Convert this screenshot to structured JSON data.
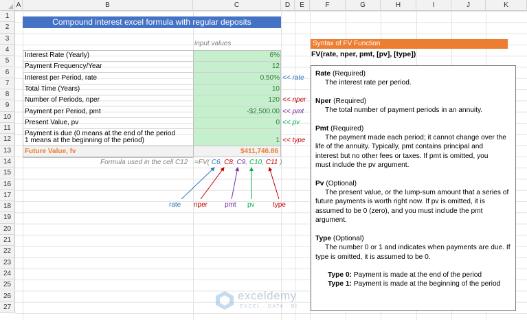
{
  "columns": [
    "A",
    "B",
    "C",
    "D",
    "E",
    "F",
    "G",
    "H",
    "I",
    "J",
    "K"
  ],
  "rows": [
    "1",
    "2",
    "3",
    "4",
    "5",
    "6",
    "7",
    "8",
    "9",
    "10",
    "11",
    "12",
    "13",
    "14",
    "15",
    "16",
    "17",
    "18",
    "19",
    "20",
    "21",
    "22",
    "23",
    "24",
    "25",
    "26",
    "27"
  ],
  "title": "Compound interest excel formula with regular deposits",
  "input_values_caption": "input values",
  "table": [
    {
      "label": "Interest Rate (Yearly)",
      "value": "6%",
      "note": ""
    },
    {
      "label": "Payment Frequency/Year",
      "value": "12",
      "note": ""
    },
    {
      "label": "Interest per Period, rate",
      "value": "0.50%",
      "note": "<< rate"
    },
    {
      "label": "Total Time (Years)",
      "value": "10",
      "note": ""
    },
    {
      "label": "Number of Periods, nper",
      "value": "120",
      "note": "<< nper"
    },
    {
      "label": "Payment per Period, pmt",
      "value": "-$2,500.00",
      "note": "<< pmt"
    },
    {
      "label": "Present Value, pv",
      "value": "0",
      "note": "<< pv"
    },
    {
      "label": "Payment is due (0 means at the end of the period",
      "value": "",
      "note": ""
    },
    {
      "label": "1 means at the beginning of the period)",
      "value": "1",
      "note": "<< type"
    }
  ],
  "future_value": {
    "label": "Future Value, fv",
    "value": "$411,746.86"
  },
  "formula": {
    "caption": "Formula used in the cell C12",
    "prefix": "=FV(",
    "c6": "C6",
    "c8": "C8",
    "c9": "C9",
    "c10": "C10",
    "c11": "C11",
    "sep": ",",
    "suffix": ")"
  },
  "arrow_labels": {
    "rate": "rate",
    "nper": "nper",
    "pmt": "pmt",
    "pv": "pv",
    "type": "type"
  },
  "syntax": {
    "heading": "Syntax of FV Function",
    "signature": "FV(rate, nper, pmt, [pv], [type])"
  },
  "help": {
    "rate_title": "Rate",
    "rate_tag": "(Required)",
    "rate_desc": "The interest rate per period.",
    "nper_title": "Nper",
    "nper_tag": "(Required)",
    "nper_desc": "The total number of payment periods in an annuity.",
    "pmt_title": "Pmt",
    "pmt_tag": "(Required)",
    "pmt_desc1": "The payment made each period; it cannot change over the",
    "pmt_desc2": "life of the annuity. Typically, pmt contains principal and",
    "pmt_desc3": "interest but no other fees or taxes. If pmt is omitted, you",
    "pmt_desc4": "must include the pv argument.",
    "pv_title": "Pv",
    "pv_tag": "(Optional)",
    "pv_desc1": "The present value, or the lump-sum amount that a series of",
    "pv_desc2": "future payments is worth right now. If pv is omitted, it is",
    "pv_desc3": "assumed to be 0 (zero), and you must include the pmt",
    "pv_desc4": "argument.",
    "type_title": "Type",
    "type_tag": "(Optional)",
    "type_desc1": "The number 0 or 1 and indicates when payments are due. If",
    "type_desc2": "type is omitted, it is assumed to be 0.",
    "type0_bold": "Type 0:",
    "type0_text": "Payment is made at the end of the period",
    "type1_bold": "Type 1:",
    "type1_text": "Payment is made at the beginning of the period"
  },
  "watermark": {
    "name": "exceldemy",
    "tagline": "EXCEL · DATA · BI"
  },
  "colors": {
    "title_band": "#4472c4",
    "syntax_band": "#ed7d31",
    "input_fill": "#c6efce",
    "fv_text": "#ed7d31",
    "rate": "#2e75b6",
    "nper": "#c00000",
    "pmt": "#7030a0",
    "pv": "#00b050",
    "type": "#c00000"
  }
}
